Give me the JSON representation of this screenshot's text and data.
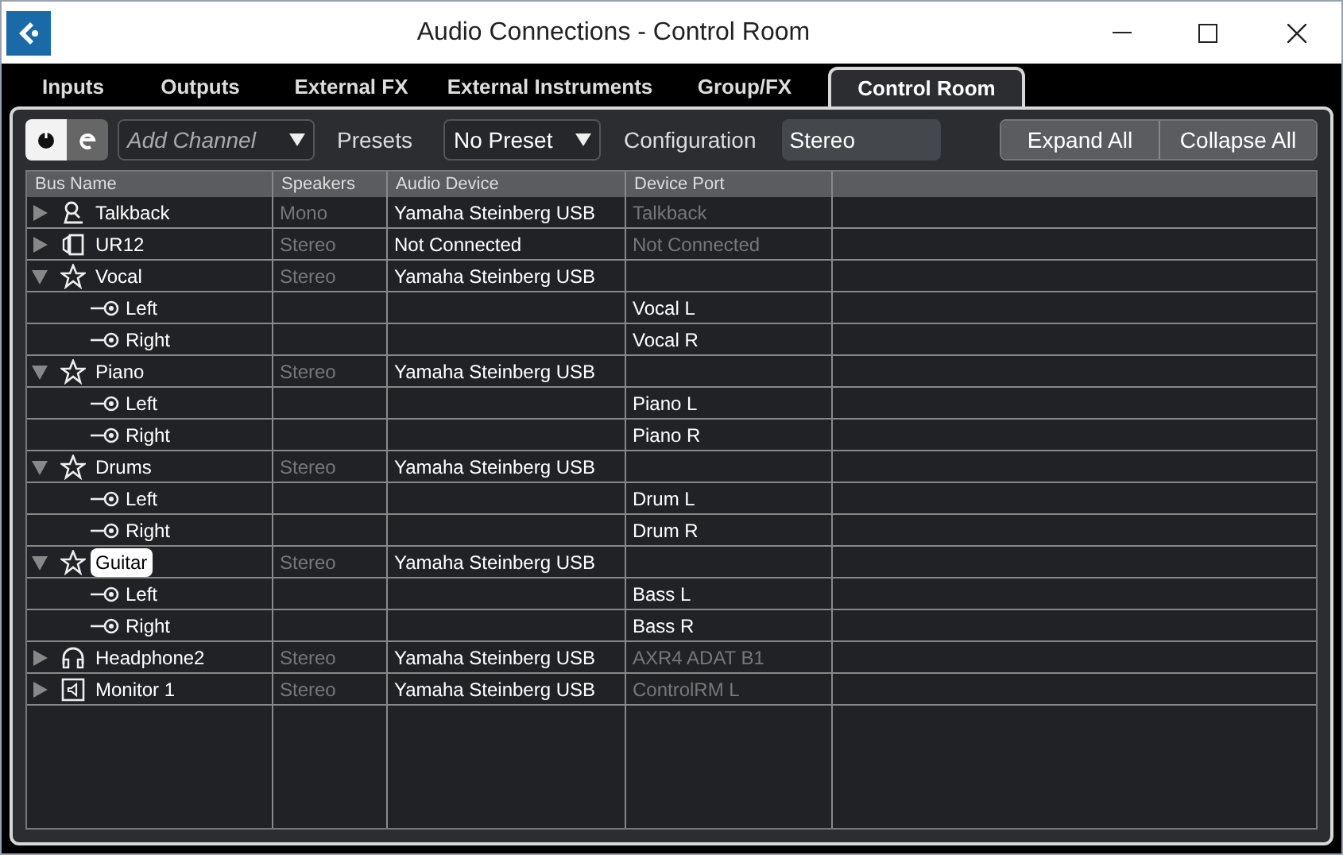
{
  "window": {
    "title": "Audio Connections - Control Room"
  },
  "tabs": [
    {
      "label": "Inputs",
      "selected": false
    },
    {
      "label": "Outputs",
      "selected": false
    },
    {
      "label": "External FX",
      "selected": false
    },
    {
      "label": "External Instruments",
      "selected": false
    },
    {
      "label": "Group/FX",
      "selected": false
    },
    {
      "label": "Control Room",
      "selected": true
    }
  ],
  "toolbar": {
    "power_on": true,
    "add_channel": {
      "label": "Add Channel"
    },
    "presets_label": "Presets",
    "preset": "No Preset",
    "configuration_label": "Configuration",
    "configuration": "Stereo",
    "buttons": [
      "Expand All",
      "Collapse All"
    ]
  },
  "table": {
    "columns": [
      "Bus Name",
      "Speakers",
      "Audio Device",
      "Device Port"
    ],
    "rows": [
      {
        "kind": "talkback",
        "name": "Talkback",
        "speakers": "Mono",
        "audio_device": "Yamaha Steinberg USB",
        "device_port": "Talkback",
        "port_dim": true,
        "expanded": false,
        "editing": false
      },
      {
        "kind": "device",
        "name": "UR12",
        "speakers": "Stereo",
        "audio_device": "Not Connected",
        "device_port": "Not Connected",
        "port_dim": true,
        "expanded": false,
        "editing": false
      },
      {
        "kind": "bus",
        "name": "Vocal",
        "speakers": "Stereo",
        "audio_device": "Yamaha Steinberg USB",
        "expanded": true,
        "editing": false,
        "children": [
          {
            "name": "Left",
            "device_port": "Vocal L"
          },
          {
            "name": "Right",
            "device_port": "Vocal R"
          }
        ]
      },
      {
        "kind": "bus",
        "name": "Piano",
        "speakers": "Stereo",
        "audio_device": "Yamaha Steinberg USB",
        "expanded": true,
        "editing": false,
        "children": [
          {
            "name": "Left",
            "device_port": "Piano L"
          },
          {
            "name": "Right",
            "device_port": "Piano R"
          }
        ]
      },
      {
        "kind": "bus",
        "name": "Drums",
        "speakers": "Stereo",
        "audio_device": "Yamaha Steinberg USB",
        "expanded": true,
        "editing": false,
        "children": [
          {
            "name": "Left",
            "device_port": "Drum L"
          },
          {
            "name": "Right",
            "device_port": "Drum R"
          }
        ]
      },
      {
        "kind": "bus",
        "name": "Guitar",
        "speakers": "Stereo",
        "audio_device": "Yamaha Steinberg USB",
        "expanded": true,
        "editing": true,
        "children": [
          {
            "name": "Left",
            "device_port": "Bass L"
          },
          {
            "name": "Right",
            "device_port": "Bass R"
          }
        ]
      },
      {
        "kind": "headphone",
        "name": "Headphone2",
        "speakers": "Stereo",
        "audio_device": "Yamaha Steinberg USB",
        "device_port": "AXR4 ADAT B1",
        "port_dim": true,
        "expanded": false,
        "editing": false
      },
      {
        "kind": "monitor",
        "name": "Monitor 1",
        "speakers": "Stereo",
        "audio_device": "Yamaha Steinberg USB",
        "device_port": "ControlRM L",
        "port_dim": true,
        "expanded": false,
        "editing": false
      }
    ]
  }
}
